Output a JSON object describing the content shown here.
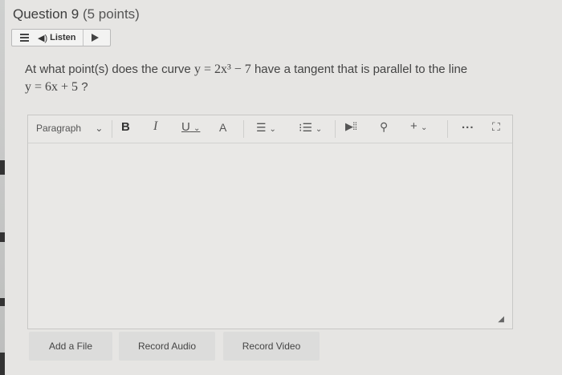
{
  "question": {
    "title": "Question 9",
    "points": "(5 points)",
    "text_prefix": "At what point(s) does  the curve",
    "curve_eq": "y = 2x³ − 7",
    "text_mid": "have a tangent that is parallel to the line",
    "line_eq": "y = 6x + 5",
    "text_end": "?"
  },
  "listen": {
    "label": "Listen",
    "menu_icon": "hamburger-menu-icon",
    "speaker_icon": "speaker-icon",
    "play_icon": "play-icon"
  },
  "toolbar": {
    "paragraph_label": "Paragraph",
    "chevron": "⌄",
    "bold": "B",
    "italic": "I",
    "underline": "U",
    "font": "A",
    "align": "☰",
    "list": "⁝☰",
    "media": "▶⁞⁞",
    "link": "⚲",
    "plus": "+",
    "more": "...",
    "fullscreen": "⛶"
  },
  "buttons": {
    "add_file": "Add a File",
    "record_audio": "Record Audio",
    "record_video": "Record Video"
  },
  "colors": {
    "background": "#e6e5e3",
    "editor_border": "#c8c8c6",
    "button_bg": "#dcdcdb"
  }
}
